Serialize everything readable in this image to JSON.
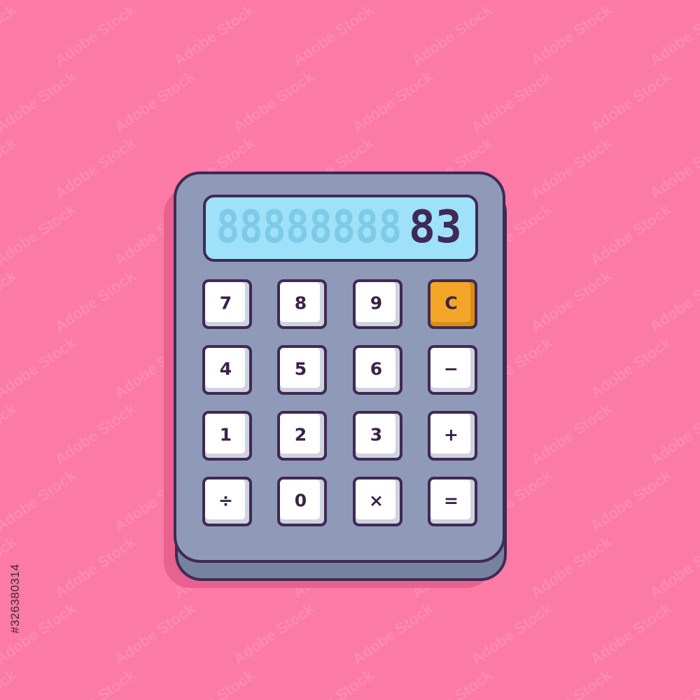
{
  "colors": {
    "background": "#fc7aa6",
    "body": "#8f9ab8",
    "body_side": "#76839f",
    "outline": "#3f2a55",
    "screen": "#9ee1f8",
    "screen_ghost": "#7ccbe8",
    "key": "#ffffff",
    "key_shade": "#cfd3de",
    "clear_key": "#f3a627",
    "clear_key_shade": "#d98d12",
    "shadow": "#e9628f"
  },
  "watermark_text": "Adobe Stock",
  "stock_id": "#326380314",
  "display": {
    "ghost_digits": "88888888",
    "value": "83"
  },
  "keys": [
    {
      "name": "key-7",
      "label": "7",
      "icon": "digit"
    },
    {
      "name": "key-8",
      "label": "8",
      "icon": "digit"
    },
    {
      "name": "key-9",
      "label": "9",
      "icon": "digit"
    },
    {
      "name": "key-clear",
      "label": "C",
      "icon": "clear"
    },
    {
      "name": "key-4",
      "label": "4",
      "icon": "digit"
    },
    {
      "name": "key-5",
      "label": "5",
      "icon": "digit"
    },
    {
      "name": "key-6",
      "label": "6",
      "icon": "digit"
    },
    {
      "name": "key-minus",
      "label": "−",
      "icon": "minus-icon"
    },
    {
      "name": "key-1",
      "label": "1",
      "icon": "digit"
    },
    {
      "name": "key-2",
      "label": "2",
      "icon": "digit"
    },
    {
      "name": "key-3",
      "label": "3",
      "icon": "digit"
    },
    {
      "name": "key-plus",
      "label": "+",
      "icon": "plus-icon"
    },
    {
      "name": "key-divide",
      "label": "÷",
      "icon": "divide-icon"
    },
    {
      "name": "key-0",
      "label": "0",
      "icon": "digit"
    },
    {
      "name": "key-multiply",
      "label": "×",
      "icon": "multiply-icon"
    },
    {
      "name": "key-equals",
      "label": "=",
      "icon": "equals-icon"
    }
  ]
}
